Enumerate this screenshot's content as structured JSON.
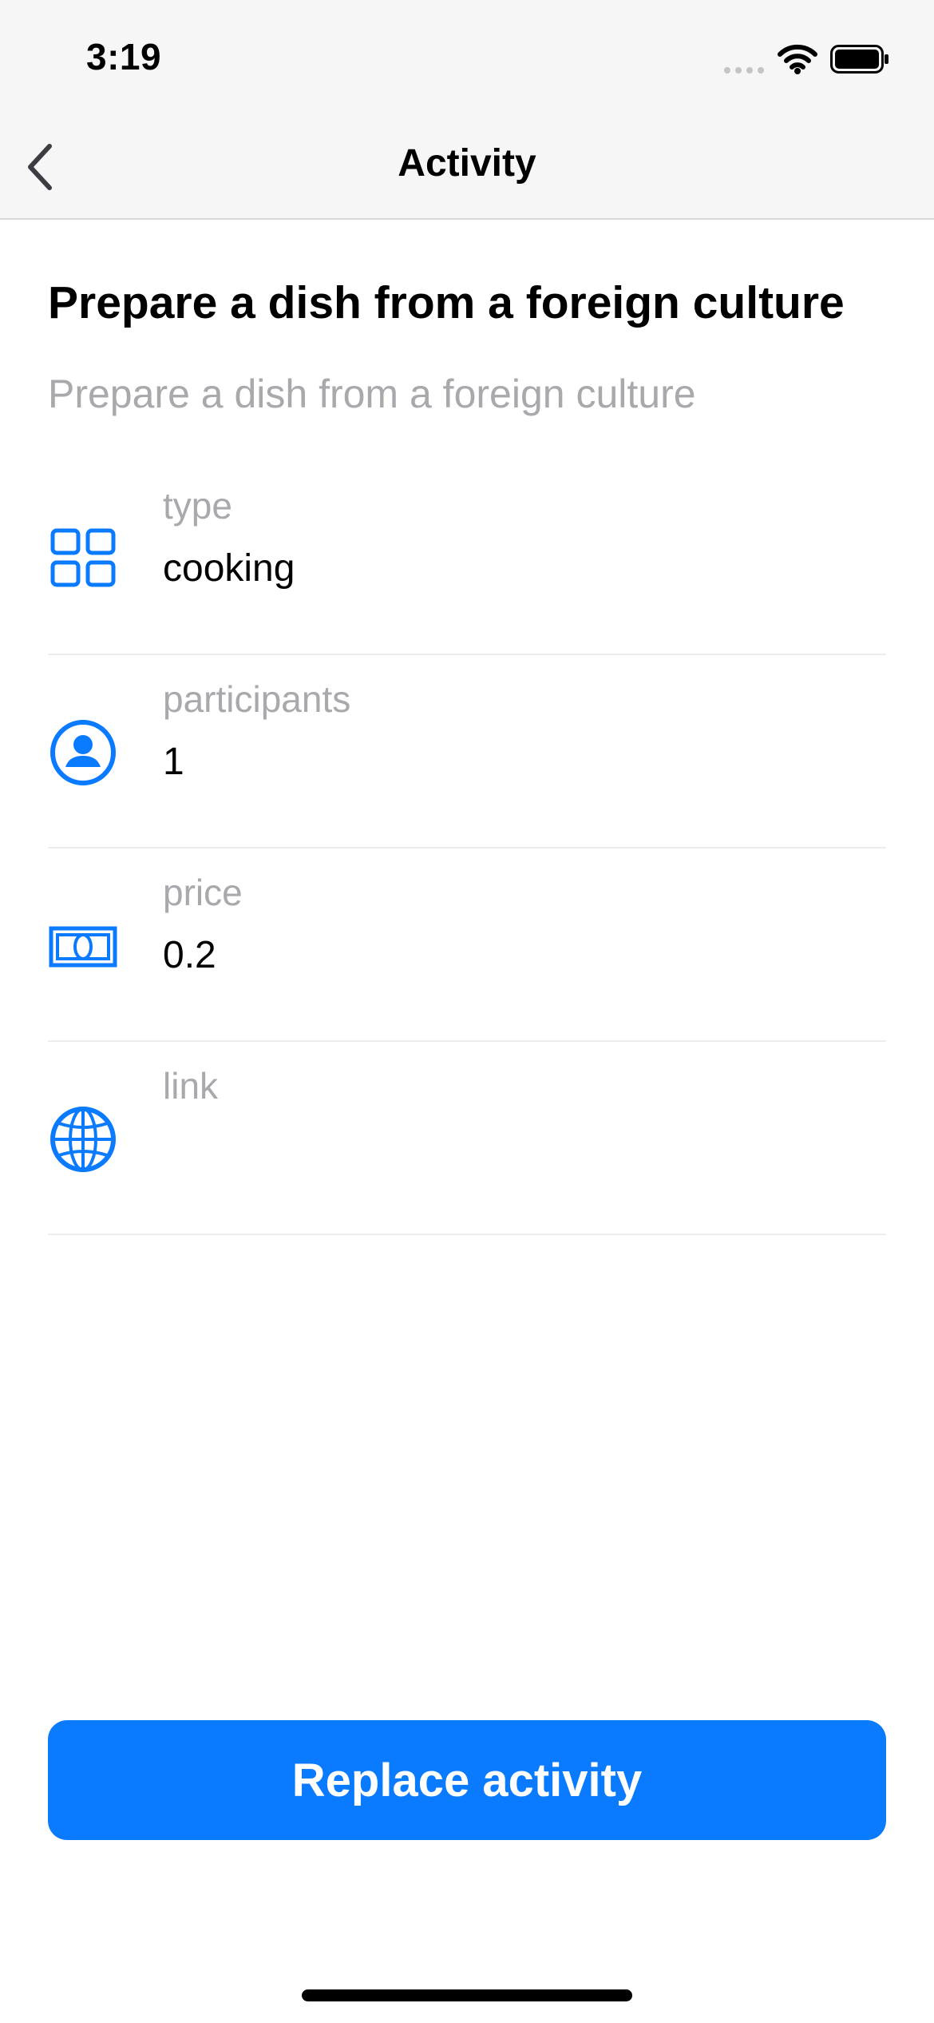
{
  "status_bar": {
    "time": "3:19"
  },
  "nav": {
    "title": "Activity",
    "back_icon": "chevron-left-icon"
  },
  "activity": {
    "title": "Prepare a dish from a foreign culture",
    "subtitle": "Prepare a dish from a foreign culture"
  },
  "details": [
    {
      "label": "type",
      "value": "cooking",
      "icon": "grid-icon"
    },
    {
      "label": "participants",
      "value": "1",
      "icon": "person-circle-icon"
    },
    {
      "label": "price",
      "value": "0.2",
      "icon": "banknote-icon"
    },
    {
      "label": "link",
      "value": "",
      "icon": "globe-icon"
    }
  ],
  "actions": {
    "replace_label": "Replace activity"
  },
  "colors": {
    "accent": "#0a7aff",
    "secondary_text": "#a8a8ad",
    "bar_background": "#f6f6f6"
  }
}
